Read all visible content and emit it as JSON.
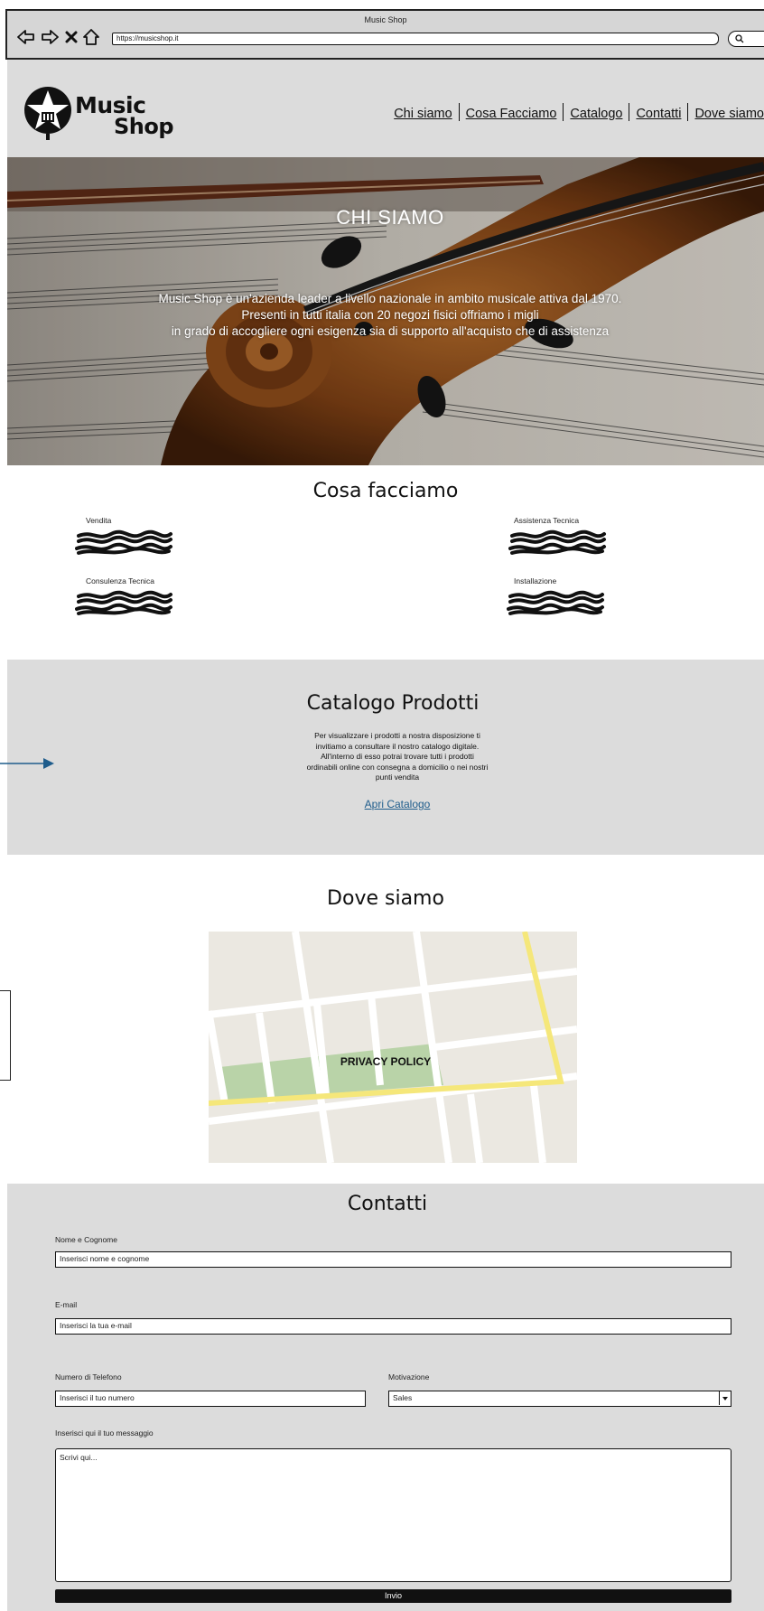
{
  "browser": {
    "title": "Music Shop",
    "url": "https://musicshop.it",
    "icons": [
      "back-arrow-icon",
      "forward-arrow-icon",
      "close-icon",
      "home-icon",
      "search-icon"
    ]
  },
  "header": {
    "logo_line1": "Music",
    "logo_line2": "Shop",
    "nav": [
      "Chi siamo",
      "Cosa Facciamo",
      "Catalogo",
      "Contatti",
      "Dove siamo"
    ]
  },
  "hero": {
    "title": "CHI SIAMO",
    "line1": "Music Shop è un'azienda leader a livello nazionale in ambito musicale attiva dal 1970.",
    "line2": "Presenti in tutti italia con 20 negozi fisici offriamo i migli",
    "line3": "in grado di accogliere ogni esigenza sia di supporto all'acquisto che di assistenza"
  },
  "services": {
    "title": "Cosa facciamo",
    "items": [
      "Vendita",
      "Assistenza Tecnica",
      "Consulenza Tecnica",
      "Installazione"
    ]
  },
  "catalog": {
    "title": "Catalogo Prodotti",
    "text": [
      "Per visualizzare i prodotti a nostra disposizione ti",
      "invitiamo a consultare il nostro catalogo digitale.",
      "All'interno di esso potrai trovare tutti i prodotti",
      "ordinabili online con consegna a domicilio o nei nostri",
      "punti vendita"
    ],
    "link": "Apri Catalogo"
  },
  "where": {
    "title": "Dove siamo",
    "privacy": "PRIVACY POLICY"
  },
  "contact": {
    "title": "Contatti",
    "name_label": "Nome e Cognome",
    "name_placeholder": "Inserisci nome e cognome",
    "email_label": "E-mail",
    "email_placeholder": "Inserisci la tua e-mail",
    "phone_label": "Numero di Telefono",
    "phone_placeholder": "Inserisci il tuo numero",
    "reason_label": "Motivazione",
    "reason_value": "Sales",
    "message_label": "Inserisci qui il tuo messaggio",
    "message_placeholder": "Scrivi qui...",
    "submit": "Invio"
  },
  "colors": {
    "link": "#1f5d8c",
    "section_gray": "#dcdcdc",
    "map_road_yellow": "#f5e77a",
    "map_park": "#b9d3a8"
  }
}
